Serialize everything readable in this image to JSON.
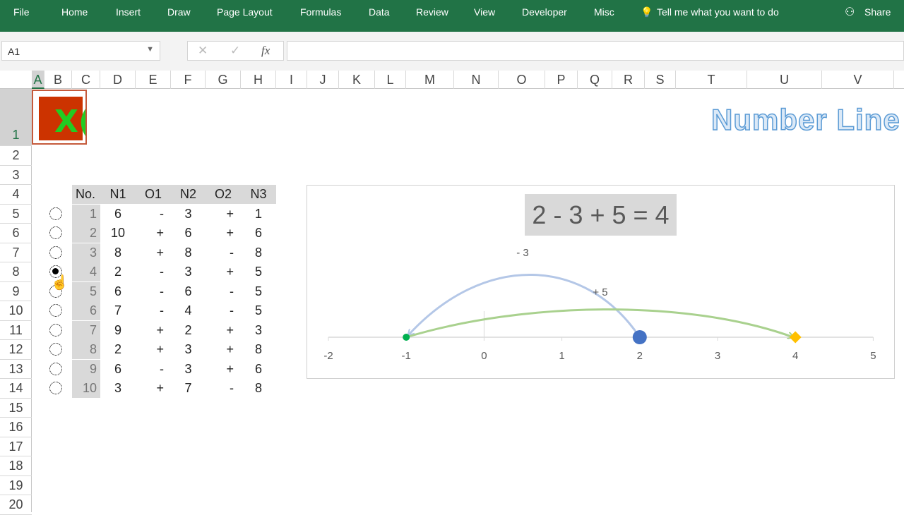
{
  "ribbon": {
    "tabs": [
      "File",
      "Home",
      "Insert",
      "Draw",
      "Page Layout",
      "Formulas",
      "Data",
      "Review",
      "View",
      "Developer",
      "Misc"
    ],
    "tell_me": "Tell me what you want to do",
    "share": "Share"
  },
  "formula_bar": {
    "name_box": "A1",
    "fx": "fx",
    "value": ""
  },
  "columns": [
    "A",
    "B",
    "C",
    "D",
    "E",
    "F",
    "G",
    "H",
    "I",
    "J",
    "K",
    "L",
    "M",
    "N",
    "O",
    "P",
    "Q",
    "R",
    "S",
    "T",
    "U",
    "V"
  ],
  "rows": [
    "1",
    "2",
    "3",
    "4",
    "5",
    "6",
    "7",
    "8",
    "9",
    "10",
    "11",
    "12",
    "13",
    "14",
    "15",
    "16",
    "17",
    "18",
    "19",
    "20"
  ],
  "logo_text": "Excel NaNa",
  "sheet_title": "Number Line",
  "table": {
    "headers": [
      "No.",
      "N1",
      "O1",
      "N2",
      "O2",
      "N3"
    ],
    "rows": [
      [
        "1",
        "6",
        "-",
        "3",
        "+",
        "1"
      ],
      [
        "2",
        "10",
        "+",
        "6",
        "+",
        "6"
      ],
      [
        "3",
        "8",
        "+",
        "8",
        "-",
        "8"
      ],
      [
        "4",
        "2",
        "-",
        "3",
        "+",
        "5"
      ],
      [
        "5",
        "6",
        "-",
        "6",
        "-",
        "5"
      ],
      [
        "6",
        "7",
        "-",
        "4",
        "-",
        "5"
      ],
      [
        "7",
        "9",
        "+",
        "2",
        "+",
        "3"
      ],
      [
        "8",
        "2",
        "+",
        "3",
        "+",
        "8"
      ],
      [
        "9",
        "6",
        "-",
        "3",
        "+",
        "6"
      ],
      [
        "10",
        "3",
        "+",
        "7",
        "-",
        "8"
      ]
    ],
    "selected_index": 3
  },
  "chart_data": {
    "type": "line",
    "title": "2 - 3 + 5 = 4",
    "xlim": [
      -2,
      5
    ],
    "ticks": [
      "-2",
      "-1",
      "0",
      "1",
      "2",
      "3",
      "4",
      "5"
    ],
    "start": 2,
    "after_first": -1,
    "result": 4,
    "annotations": [
      {
        "text": "- 3",
        "from": 2,
        "to": -1,
        "color": "#b4c7e7"
      },
      {
        "text": "+ 5",
        "from": -1,
        "to": 4,
        "color": "#a9d18e"
      }
    ],
    "markers": {
      "start": "#4472c4",
      "mid": "#00b050",
      "end": "#ffc000"
    }
  }
}
